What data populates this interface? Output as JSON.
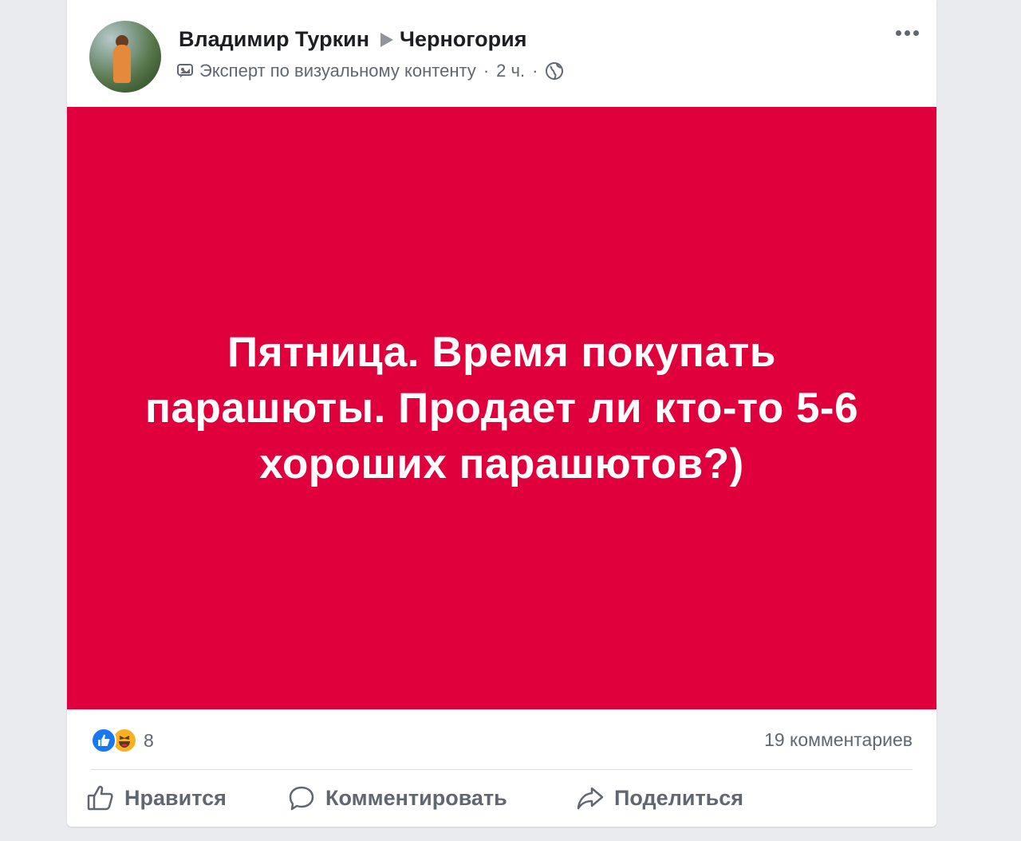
{
  "post": {
    "author": "Владимир Туркин",
    "group": "Черногория",
    "badge": "Эксперт по визуальному контенту",
    "time": "2 ч.",
    "separator": "·",
    "text_lines": [
      "Пятница. Время покупать",
      "парашюты. Продает ли кто-то 5-6",
      "хороших парашютов?)"
    ],
    "background_color": "#e0003b",
    "reactions": {
      "icons": [
        "like-icon",
        "haha-icon"
      ],
      "count": "8"
    },
    "comments": "19 комментариев"
  },
  "actions": {
    "like": "Нравится",
    "comment": "Комментировать",
    "share": "Поделиться"
  },
  "colors": {
    "page_background": "#e9ebee",
    "card": "#ffffff",
    "muted_text": "#606770",
    "like_blue": "#1877f2"
  }
}
